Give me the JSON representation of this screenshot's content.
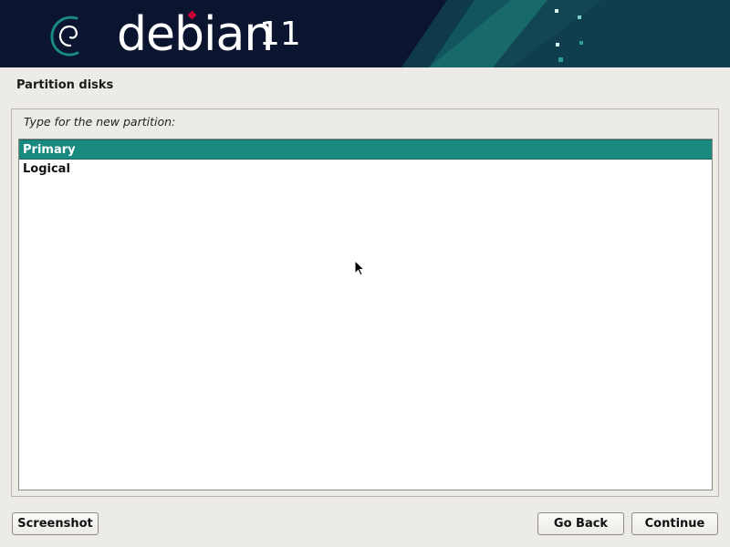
{
  "banner": {
    "brand": "debian",
    "version": "11",
    "colors": {
      "background": "#0c1530",
      "accent": "#1a8a80",
      "logo_red": "#c70036"
    }
  },
  "page": {
    "title": "Partition disks",
    "prompt": "Type for the new partition:"
  },
  "options": [
    {
      "label": "Primary",
      "selected": true
    },
    {
      "label": "Logical",
      "selected": false
    }
  ],
  "buttons": {
    "screenshot": "Screenshot",
    "go_back": "Go Back",
    "continue": "Continue"
  },
  "icons": [
    "debian-swirl-icon",
    "mouse-cursor-icon"
  ]
}
